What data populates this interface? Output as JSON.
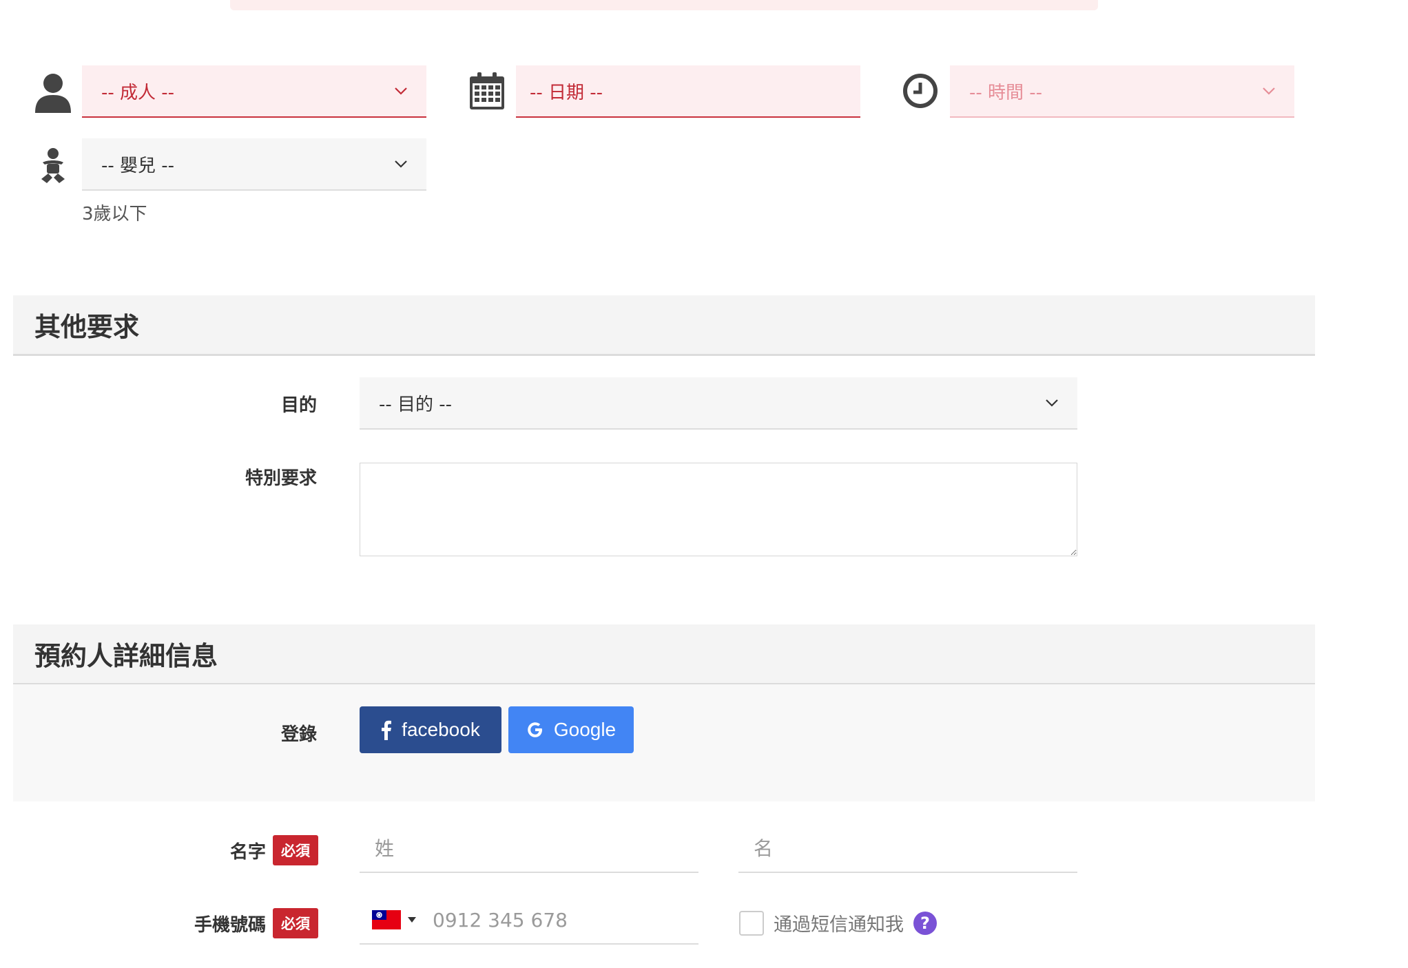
{
  "booking": {
    "adults": {
      "value": "-- 成人 --"
    },
    "date": {
      "value": "-- 日期 --"
    },
    "time": {
      "value": "-- 時間 --"
    },
    "infants": {
      "value": "-- 嬰兒 --",
      "hint": "3歲以下"
    }
  },
  "other_requests": {
    "title": "其他要求",
    "purpose": {
      "label": "目的",
      "value": "-- 目的 --"
    },
    "special": {
      "label": "特別要求",
      "value": ""
    }
  },
  "booker_details": {
    "title": "預約人詳細信息",
    "login": {
      "label": "登錄",
      "facebook": "facebook",
      "google": "Google"
    },
    "name": {
      "label": "名字",
      "required": "必須",
      "last_placeholder": "姓",
      "first_placeholder": "名"
    },
    "phone": {
      "label": "手機號碼",
      "required": "必須",
      "placeholder": "0912 345 678",
      "sms_label": "通過短信通知我",
      "help": "?"
    }
  },
  "colors": {
    "accent_red": "#c9303c",
    "required_badge": "#c9262f",
    "facebook": "#2b4d8f",
    "google": "#4285f4",
    "help": "#7a52d6"
  }
}
